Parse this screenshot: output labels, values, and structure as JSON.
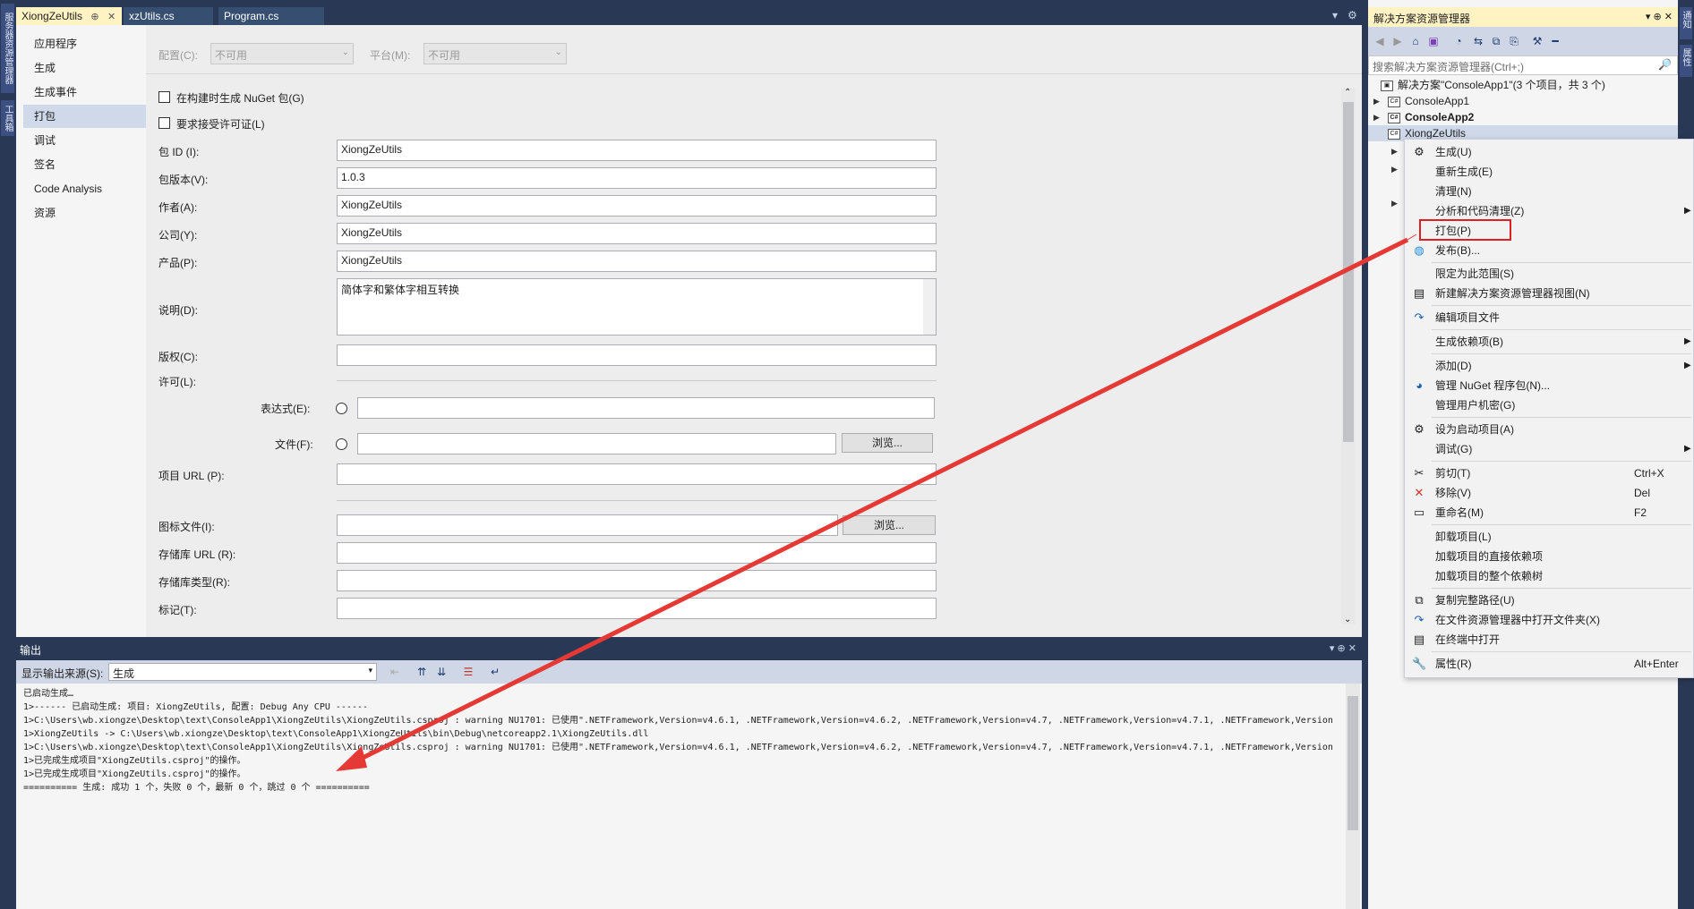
{
  "left_strip": {
    "tabs": [
      "服务器资源管理器",
      "工具箱"
    ]
  },
  "right_strip": {
    "tabs": [
      "通知",
      "属性"
    ]
  },
  "tabs": [
    {
      "label": "XiongZeUtils",
      "pin": "⊕",
      "close": "✕"
    },
    {
      "label": "xzUtils.cs"
    },
    {
      "label": "Program.cs"
    }
  ],
  "strip_controls": {
    "dropdown": "▾",
    "settings": "⚙"
  },
  "nav": {
    "items": [
      "应用程序",
      "生成",
      "生成事件",
      "打包",
      "调试",
      "签名",
      "Code Analysis",
      "资源"
    ],
    "selected": "打包"
  },
  "config": {
    "config_label": "配置(C):",
    "config_value": "不可用",
    "platform_label": "平台(M):",
    "platform_value": "不可用"
  },
  "package": {
    "gen_nuget_label": "在构建时生成 NuGet 包(G)",
    "require_license_label": "要求接受许可证(L)",
    "id_label": "包 ID (I):",
    "id_value": "XiongZeUtils",
    "version_label": "包版本(V):",
    "version_value": "1.0.3",
    "authors_label": "作者(A):",
    "authors_value": "XiongZeUtils",
    "company_label": "公司(Y):",
    "company_value": "XiongZeUtils",
    "product_label": "产品(P):",
    "product_value": "XiongZeUtils",
    "description_label": "说明(D):",
    "description_value": "简体字和繁体字相互转换",
    "copyright_label": "版权(C):",
    "copyright_value": "",
    "license_label": "许可(L):",
    "expression_label": "表达式(E):",
    "file_label": "文件(F):",
    "browse_label": "浏览...",
    "project_url_label": "项目 URL (P):",
    "icon_label": "图标文件(I):",
    "repo_url_label": "存储库 URL (R):",
    "repo_type_label": "存储库类型(R):",
    "tags_label": "标记(T):"
  },
  "output": {
    "title": "输出",
    "source_label": "显示输出来源(S):",
    "source_value": "生成",
    "controls": "▾ ⊕ ✕",
    "lines": [
      "已启动生成…",
      "1>------ 已启动生成: 项目: XiongZeUtils, 配置: Debug Any CPU ------",
      "1>C:\\Users\\wb.xiongze\\Desktop\\text\\ConsoleApp1\\XiongZeUtils\\XiongZeUtils.csproj : warning NU1701: 已使用\".NETFramework,Version=v4.6.1, .NETFramework,Version=v4.6.2, .NETFramework,Version=v4.7, .NETFramework,Version=v4.7.1, .NETFramework,Version",
      "1>XiongZeUtils -> C:\\Users\\wb.xiongze\\Desktop\\text\\ConsoleApp1\\XiongZeUtils\\bin\\Debug\\netcoreapp2.1\\XiongZeUtils.dll",
      "1>C:\\Users\\wb.xiongze\\Desktop\\text\\ConsoleApp1\\XiongZeUtils\\XiongZeUtils.csproj : warning NU1701: 已使用\".NETFramework,Version=v4.6.1, .NETFramework,Version=v4.6.2, .NETFramework,Version=v4.7, .NETFramework,Version=v4.7.1, .NETFramework,Version",
      "1>已完成生成项目\"XiongZeUtils.csproj\"的操作。",
      "1>已完成生成项目\"XiongZeUtils.csproj\"的操作。",
      "========== 生成: 成功 1 个，失败 0 个，最新 0 个，跳过 0 个 =========="
    ]
  },
  "solution": {
    "title": "解决方案资源管理器",
    "controls": "▾ ⊕ ✕",
    "search_placeholder": "搜索解决方案资源管理器(Ctrl+;)",
    "search_icon": "🔎",
    "tree": [
      {
        "label": "解决方案\"ConsoleApp1\"(3 个项目，共 3 个)",
        "icon": "solution-icon"
      },
      {
        "label": "ConsoleApp1",
        "icon": "csharp-project-icon"
      },
      {
        "label": "ConsoleApp2",
        "icon": "csharp-project-icon",
        "bold": true
      },
      {
        "label": "XiongZeUtils",
        "icon": "csharp-project-icon",
        "selected": true
      }
    ]
  },
  "context_menu": {
    "items": [
      {
        "label": "生成(U)",
        "icon": "build-icon"
      },
      {
        "label": "重新生成(E)"
      },
      {
        "label": "清理(N)"
      },
      {
        "label": "分析和代码清理(Z)",
        "submenu": true
      },
      {
        "label": "打包(P)",
        "highlighted": true
      },
      {
        "label": "发布(B)...",
        "icon": "globe-icon"
      },
      {
        "sep": true
      },
      {
        "label": "限定为此范围(S)"
      },
      {
        "label": "新建解决方案资源管理器视图(N)",
        "icon": "new-view-icon"
      },
      {
        "sep": true
      },
      {
        "label": "编辑项目文件",
        "icon": "refresh-arrow-icon"
      },
      {
        "sep": true
      },
      {
        "label": "生成依赖项(B)",
        "submenu": true
      },
      {
        "sep": true
      },
      {
        "label": "添加(D)",
        "submenu": true
      },
      {
        "label": "管理 NuGet 程序包(N)...",
        "icon": "nuget-icon"
      },
      {
        "label": "管理用户机密(G)"
      },
      {
        "sep": true
      },
      {
        "label": "设为启动项目(A)",
        "icon": "gear-icon"
      },
      {
        "label": "调试(G)",
        "submenu": true
      },
      {
        "sep": true
      },
      {
        "label": "剪切(T)",
        "shortcut": "Ctrl+X",
        "icon": "scissors-icon"
      },
      {
        "label": "移除(V)",
        "shortcut": "Del",
        "icon": "delete-x-icon"
      },
      {
        "label": "重命名(M)",
        "shortcut": "F2",
        "icon": "rename-icon"
      },
      {
        "sep": true
      },
      {
        "label": "卸载项目(L)"
      },
      {
        "label": "加载项目的直接依赖项"
      },
      {
        "label": "加载项目的整个依赖树"
      },
      {
        "sep": true
      },
      {
        "label": "复制完整路径(U)",
        "icon": "copy-icon"
      },
      {
        "label": "在文件资源管理器中打开文件夹(X)",
        "icon": "folder-arrow-icon"
      },
      {
        "label": "在终端中打开",
        "icon": "terminal-icon"
      },
      {
        "sep": true
      },
      {
        "label": "属性(R)",
        "shortcut": "Alt+Enter",
        "icon": "wrench-icon"
      }
    ]
  },
  "colors": {
    "chrome": "#293955",
    "tab_active": "#fff3c4",
    "highlight_box": "#e02020",
    "arrow": "#e53935",
    "selection": "#cfd9ea"
  }
}
